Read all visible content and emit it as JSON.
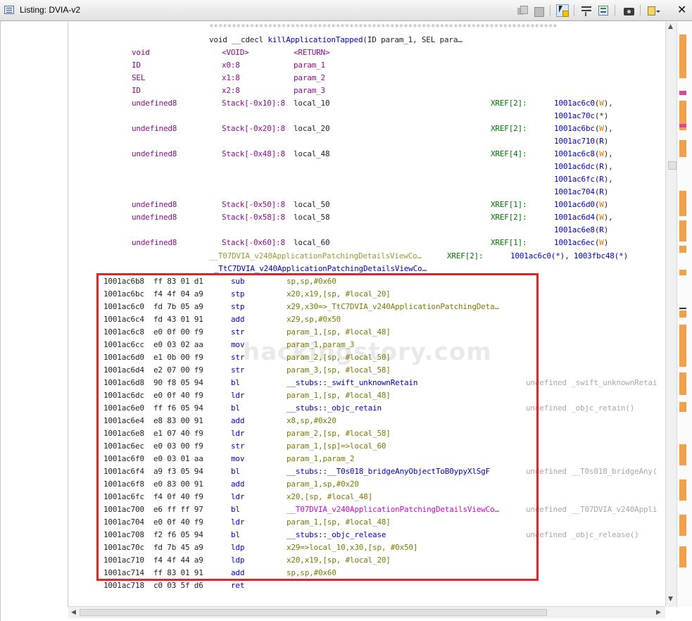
{
  "window": {
    "title": "Listing:  DVIA-v2"
  },
  "toolbar": {
    "icons": [
      "copy-icon",
      "paste-icon",
      "cursor-select-icon",
      "field-layout-icon",
      "diff-view-icon",
      "snapshot-camera-icon",
      "options-icon",
      "close-icon"
    ]
  },
  "header": {
    "stars": "*****************************************************************************",
    "signature_prefix": "void __cdecl ",
    "signature_name": "killApplicationTapped",
    "signature_suffix": "(ID param_1, SEL para…"
  },
  "params": [
    {
      "type": "void",
      "loc": "<VOID>",
      "name": "<RETURN>",
      "xref": "",
      "refs": []
    },
    {
      "type": "ID",
      "loc": "x0:8",
      "name": "param_1",
      "xref": "",
      "refs": []
    },
    {
      "type": "SEL",
      "loc": "x1:8",
      "name": "param_2",
      "xref": "",
      "refs": []
    },
    {
      "type": "ID",
      "loc": "x2:8",
      "name": "param_3",
      "xref": "",
      "refs": []
    },
    {
      "type": "undefined8",
      "loc": "Stack[-0x10]:8",
      "name": "local_10",
      "xref": "XREF[2]:",
      "refs": [
        [
          "1001ac6c0",
          "W",
          ","
        ],
        [
          "1001ac70c",
          "*",
          ""
        ]
      ]
    },
    {
      "type": "undefined8",
      "loc": "Stack[-0x20]:8",
      "name": "local_20",
      "xref": "XREF[2]:",
      "refs": [
        [
          "1001ac6bc",
          "W",
          ","
        ],
        [
          "1001ac710",
          "R",
          ""
        ]
      ]
    },
    {
      "type": "undefined8",
      "loc": "Stack[-0x48]:8",
      "name": "local_48",
      "xref": "XREF[4]:",
      "refs": [
        [
          "1001ac6c8",
          "W",
          ","
        ],
        [
          "1001ac6dc",
          "R",
          ","
        ],
        [
          "1001ac6fc",
          "R",
          ","
        ],
        [
          "1001ac704",
          "R",
          ""
        ]
      ]
    },
    {
      "type": "undefined8",
      "loc": "Stack[-0x50]:8",
      "name": "local_50",
      "xref": "XREF[1]:",
      "refs": [
        [
          "1001ac6d0",
          "W",
          ""
        ]
      ]
    },
    {
      "type": "undefined8",
      "loc": "Stack[-0x58]:8",
      "name": "local_58",
      "xref": "XREF[2]:",
      "refs": [
        [
          "1001ac6d4",
          "W",
          ","
        ],
        [
          "1001ac6e8",
          "R",
          ""
        ]
      ]
    },
    {
      "type": "undefined8",
      "loc": "Stack[-0x60]:8",
      "name": "local_60",
      "xref": "XREF[1]:",
      "refs": [
        [
          "1001ac6ec",
          "W",
          ""
        ]
      ]
    }
  ],
  "labels": {
    "label1": "__T07DVIA_v240ApplicationPatchingDetailsViewCo…",
    "label1_xref": "XREF[2]:",
    "label1_refs": "1001ac6c0(*), 1003fbc48(*)",
    "label2": "_TtC7DVIA_v240ApplicationPatchingDetailsViewCo…"
  },
  "instructions": [
    {
      "addr": "1001ac6b8",
      "bytes": "ff 83 01 d1",
      "mn": "sub",
      "ops": "sp,sp,#0x60",
      "cmt": ""
    },
    {
      "addr": "1001ac6bc",
      "bytes": "f4 4f 04 a9",
      "mn": "stp",
      "ops": "x20,x19,[sp, #local_20]",
      "cmt": ""
    },
    {
      "addr": "1001ac6c0",
      "bytes": "fd 7b 05 a9",
      "mn": "stp",
      "ops": "x29,x30=>_TtC7DVIA_v240ApplicationPatchingDeta…",
      "cmt": ""
    },
    {
      "addr": "1001ac6c4",
      "bytes": "fd 43 01 91",
      "mn": "add",
      "ops": "x29,sp,#0x50",
      "cmt": ""
    },
    {
      "addr": "1001ac6c8",
      "bytes": "e0 0f 00 f9",
      "mn": "str",
      "ops": "param_1,[sp, #local_48]",
      "cmt": ""
    },
    {
      "addr": "1001ac6cc",
      "bytes": "e0 03 02 aa",
      "mn": "mov",
      "ops": "param_1,param_3",
      "cmt": ""
    },
    {
      "addr": "1001ac6d0",
      "bytes": "e1 0b 00 f9",
      "mn": "str",
      "ops": "param_2,[sp, #local_50]",
      "cmt": ""
    },
    {
      "addr": "1001ac6d4",
      "bytes": "e2 07 00 f9",
      "mn": "str",
      "ops": "param_3,[sp, #local_58]",
      "cmt": ""
    },
    {
      "addr": "1001ac6d8",
      "bytes": "90 f8 05 94",
      "mn": "bl",
      "ops": "__stubs::_swift_unknownRetain",
      "cmt": "undefined _swift_unknownRetai"
    },
    {
      "addr": "1001ac6dc",
      "bytes": "e0 0f 40 f9",
      "mn": "ldr",
      "ops": "param_1,[sp, #local_48]",
      "cmt": ""
    },
    {
      "addr": "1001ac6e0",
      "bytes": "ff f6 05 94",
      "mn": "bl",
      "ops": "__stubs::_objc_retain",
      "cmt": "undefined _objc_retain()"
    },
    {
      "addr": "1001ac6e4",
      "bytes": "e8 83 00 91",
      "mn": "add",
      "ops": "x8,sp,#0x20",
      "cmt": ""
    },
    {
      "addr": "1001ac6e8",
      "bytes": "e1 07 40 f9",
      "mn": "ldr",
      "ops": "param_2,[sp, #local_58]",
      "cmt": ""
    },
    {
      "addr": "1001ac6ec",
      "bytes": "e0 03 00 f9",
      "mn": "str",
      "ops": "param_1,[sp]=>local_60",
      "cmt": ""
    },
    {
      "addr": "1001ac6f0",
      "bytes": "e0 03 01 aa",
      "mn": "mov",
      "ops": "param_1,param_2",
      "cmt": ""
    },
    {
      "addr": "1001ac6f4",
      "bytes": "a9 f3 05 94",
      "mn": "bl",
      "ops": "__stubs::__T0s018_bridgeAnyObjectToB0ypyXlSgF",
      "cmt": "undefined __T0s018_bridgeAny("
    },
    {
      "addr": "1001ac6f8",
      "bytes": "e0 83 00 91",
      "mn": "add",
      "ops": "param_1,sp,#0x20",
      "cmt": ""
    },
    {
      "addr": "1001ac6fc",
      "bytes": "f4 0f 40 f9",
      "mn": "ldr",
      "ops": "x20,[sp, #local_48]",
      "cmt": ""
    },
    {
      "addr": "1001ac700",
      "bytes": "e6 ff ff 97",
      "mn": "bl",
      "ops": "__T07DVIA_v240ApplicationPatchingDetailsViewCo…",
      "cmt": "undefined __T07DVIA_v240Appli"
    },
    {
      "addr": "1001ac704",
      "bytes": "e0 0f 40 f9",
      "mn": "ldr",
      "ops": "param_1,[sp, #local_48]",
      "cmt": ""
    },
    {
      "addr": "1001ac708",
      "bytes": "f2 f6 05 94",
      "mn": "bl",
      "ops": "__stubs::_objc_release",
      "cmt": "undefined _objc_release()"
    },
    {
      "addr": "1001ac70c",
      "bytes": "fd 7b 45 a9",
      "mn": "ldp",
      "ops": "x29=>local_10,x30,[sp, #0x50]",
      "cmt": ""
    },
    {
      "addr": "1001ac710",
      "bytes": "f4 4f 44 a9",
      "mn": "ldp",
      "ops": "x20,x19,[sp, #local_20]",
      "cmt": ""
    },
    {
      "addr": "1001ac714",
      "bytes": "ff 83 01 91",
      "mn": "add",
      "ops": "sp,sp,#0x60",
      "cmt": ""
    },
    {
      "addr": "1001ac718",
      "bytes": "c0 03 5f d6",
      "mn": "ret",
      "ops": "",
      "cmt": ""
    }
  ],
  "watermark": "hackingstory.com",
  "colors": {
    "highlight_box": "#e8202e",
    "type": "#8b0c8b",
    "xref": "#007400",
    "write": "#e07800",
    "read": "#0000c8"
  }
}
